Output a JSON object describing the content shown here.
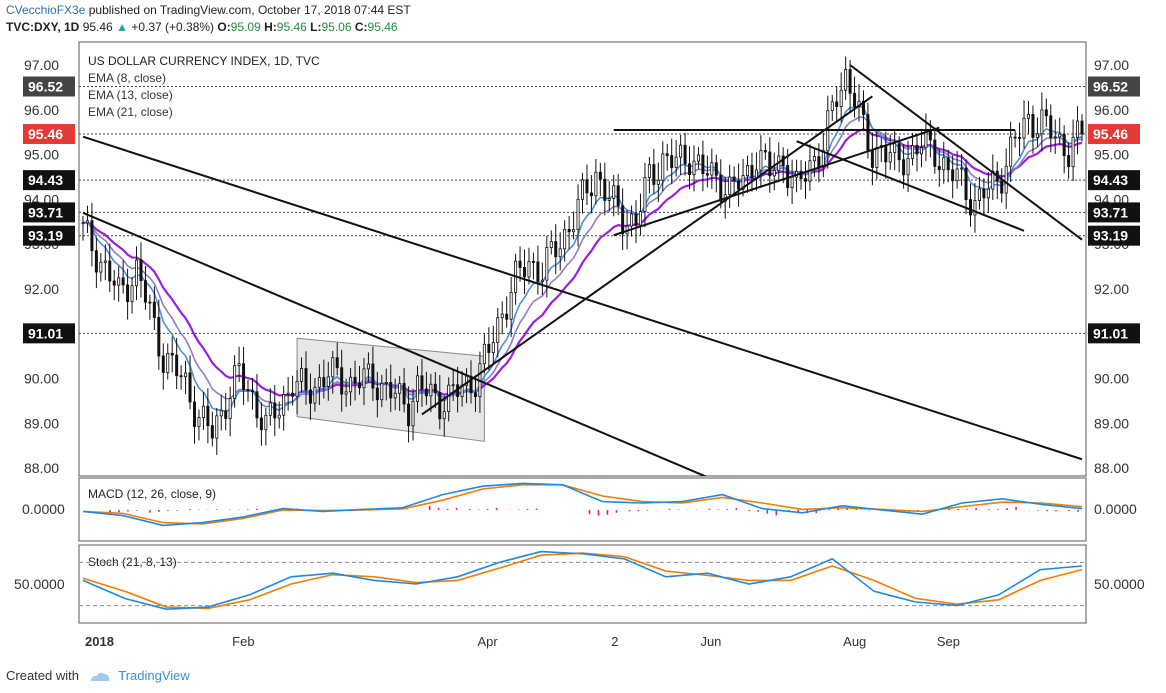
{
  "header": {
    "author": "CVecchioFX3e",
    "published_text": "published on TradingView.com, October 17, 2018 07:44 EST",
    "symbol_line": {
      "symbol": "TVC:DXY, 1D",
      "last": "95.46",
      "change_arrow": "▲",
      "change": "+0.37 (+0.38%)",
      "o_label": "O:",
      "o": "95.09",
      "h_label": "H:",
      "h": "95.46",
      "l_label": "L:",
      "l": "95.06",
      "c_label": "C:",
      "c": "95.46"
    }
  },
  "footer": {
    "created_with": "Created with",
    "brand": "TradingView"
  },
  "colors": {
    "ema8": "#4a90e2",
    "ema13": "#8b7fc7",
    "ema21": "#9b1fe0",
    "macd": "#1e88e5",
    "signal": "#f57c00",
    "hist": "#e91e63",
    "last_price_box": "#e53935",
    "level_box": "#111111",
    "channel_fill": "#e3e3e3"
  },
  "chart_data": [
    {
      "type": "candlestick",
      "title": "US DOLLAR CURRENCY INDEX, 1D, TVC",
      "legend": [
        "EMA (8, close)",
        "EMA (13, close)",
        "EMA (21, close)"
      ],
      "ylim": [
        87.8,
        97.3
      ],
      "y_ticks": [
        "88.00",
        "89.00",
        "90.00",
        "91.00",
        "92.00",
        "93.00",
        "94.00",
        "95.00",
        "96.00",
        "97.00"
      ],
      "x_ticks": [
        "2018",
        "Feb",
        "Apr",
        "2",
        "Jun",
        "Aug",
        "Sep"
      ],
      "level_lines": [
        96.52,
        95.46,
        94.43,
        93.71,
        93.19,
        91.01
      ],
      "level_labels": [
        "96.52",
        "95.46",
        "94.43",
        "93.71",
        "93.19",
        "91.01"
      ],
      "last_price": "95.46",
      "close_path": [
        [
          0,
          93.3
        ],
        [
          3,
          92.8
        ],
        [
          8,
          91.9
        ],
        [
          12,
          92.4
        ],
        [
          15,
          91.5
        ],
        [
          18,
          90.5
        ],
        [
          23,
          89.9
        ],
        [
          26,
          89.1
        ],
        [
          29,
          88.8
        ],
        [
          32,
          89.5
        ],
        [
          35,
          90.1
        ],
        [
          38,
          89.6
        ],
        [
          41,
          88.9
        ],
        [
          44,
          89.4
        ],
        [
          47,
          89.9
        ],
        [
          50,
          89.7
        ],
        [
          55,
          90.1
        ],
        [
          60,
          89.9
        ],
        [
          65,
          90.0
        ],
        [
          70,
          89.6
        ],
        [
          73,
          89.4
        ],
        [
          75,
          89.8
        ],
        [
          80,
          89.5
        ],
        [
          84,
          89.7
        ],
        [
          88,
          90.0
        ],
        [
          91,
          90.6
        ],
        [
          94,
          91.5
        ],
        [
          97,
          92.2
        ],
        [
          100,
          92.6
        ],
        [
          103,
          92.4
        ],
        [
          106,
          92.9
        ],
        [
          109,
          93.4
        ],
        [
          112,
          94.0
        ],
        [
          115,
          94.6
        ],
        [
          118,
          94.0
        ],
        [
          121,
          93.6
        ],
        [
          124,
          93.5
        ],
        [
          127,
          94.5
        ],
        [
          130,
          94.9
        ],
        [
          133,
          94.8
        ],
        [
          136,
          95.0
        ],
        [
          139,
          94.6
        ],
        [
          142,
          94.5
        ],
        [
          145,
          94.2
        ],
        [
          148,
          94.4
        ],
        [
          151,
          95.0
        ],
        [
          154,
          94.6
        ],
        [
          157,
          94.9
        ],
        [
          160,
          94.2
        ],
        [
          163,
          94.8
        ],
        [
          166,
          95.2
        ],
        [
          169,
          96.3
        ],
        [
          171,
          96.8
        ],
        [
          173,
          96.3
        ],
        [
          175,
          95.5
        ],
        [
          177,
          95.0
        ],
        [
          179,
          95.2
        ],
        [
          182,
          94.8
        ],
        [
          185,
          95.0
        ],
        [
          188,
          95.2
        ],
        [
          191,
          95.1
        ],
        [
          194,
          94.6
        ],
        [
          197,
          94.4
        ],
        [
          200,
          93.9
        ],
        [
          203,
          94.2
        ],
        [
          206,
          94.6
        ],
        [
          209,
          95.3
        ],
        [
          212,
          95.8
        ],
        [
          215,
          95.7
        ],
        [
          218,
          95.4
        ],
        [
          221,
          95.1
        ],
        [
          224,
          95.46
        ]
      ],
      "trendlines": [
        {
          "from": [
            0,
            95.4
          ],
          "to": [
            224,
            88.2
          ]
        },
        {
          "from": [
            0,
            93.7
          ],
          "to": [
            140,
            87.8
          ]
        },
        {
          "from": [
            76,
            89.2
          ],
          "to": [
            177,
            96.3
          ]
        },
        {
          "from": [
            119,
            93.2
          ],
          "to": [
            192,
            95.6
          ]
        },
        {
          "from": [
            119,
            95.55
          ],
          "to": [
            209,
            95.55
          ]
        },
        {
          "from": [
            172,
            97.0
          ],
          "to": [
            224,
            93.1
          ]
        },
        {
          "from": [
            160,
            95.3
          ],
          "to": [
            211,
            93.3
          ]
        }
      ],
      "channel": {
        "start": 48,
        "end": 90,
        "upper": [
          90.9,
          90.5
        ],
        "lower": [
          89.15,
          88.6
        ]
      }
    },
    {
      "type": "line",
      "title": "MACD (12, 26, close, 9)",
      "y_tick": "0.0000",
      "series": [
        {
          "name": "MACD",
          "values": [
            -0.05,
            -0.2,
            -0.55,
            -0.45,
            -0.25,
            0.05,
            -0.05,
            0.02,
            0.08,
            0.55,
            0.85,
            0.95,
            0.9,
            0.3,
            0.25,
            0.3,
            0.55,
            0.05,
            -0.1,
            0.15,
            0.0,
            -0.15,
            0.25,
            0.4,
            0.2,
            0.05
          ]
        },
        {
          "name": "Signal",
          "values": [
            -0.05,
            -0.12,
            -0.45,
            -0.5,
            -0.3,
            0.0,
            -0.02,
            0.0,
            0.04,
            0.35,
            0.75,
            0.9,
            0.9,
            0.5,
            0.3,
            0.25,
            0.45,
            0.25,
            0.02,
            0.08,
            0.02,
            -0.05,
            0.12,
            0.28,
            0.25,
            0.12
          ]
        }
      ]
    },
    {
      "type": "line",
      "title": "Stoch (21, 8, 13)",
      "y_tick": "50.0000",
      "levels": [
        80,
        20
      ],
      "series": [
        {
          "name": "%K",
          "values": [
            55,
            30,
            15,
            18,
            35,
            60,
            65,
            55,
            50,
            60,
            80,
            95,
            92,
            85,
            60,
            65,
            50,
            60,
            85,
            40,
            25,
            20,
            35,
            70,
            75
          ]
        },
        {
          "name": "%D",
          "values": [
            58,
            40,
            18,
            16,
            28,
            50,
            63,
            60,
            52,
            55,
            72,
            90,
            93,
            88,
            68,
            62,
            55,
            55,
            75,
            55,
            30,
            22,
            28,
            55,
            70
          ]
        }
      ]
    }
  ]
}
